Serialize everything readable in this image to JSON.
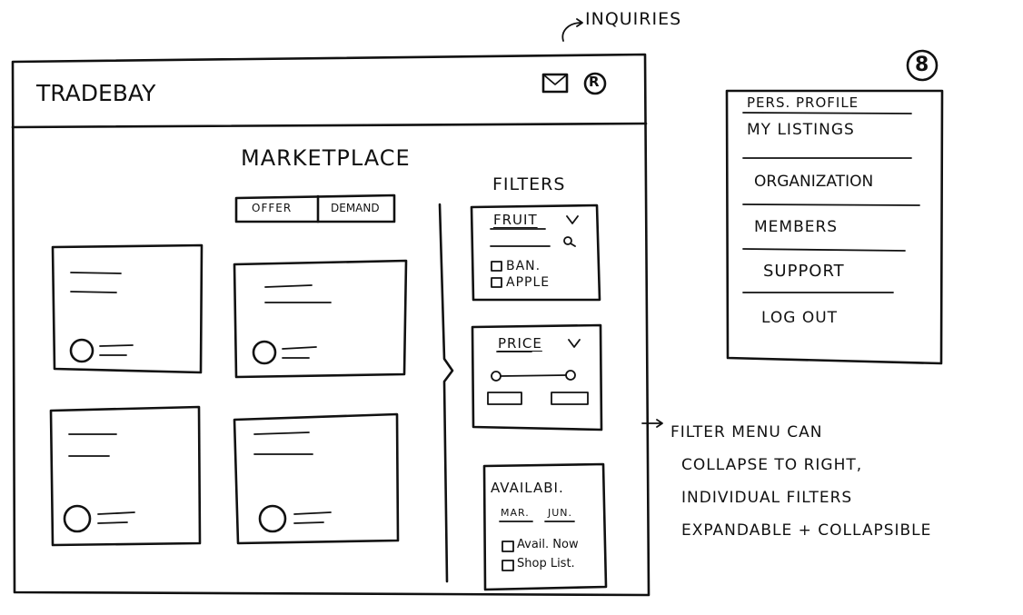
{
  "annotations": {
    "inquiries": "INQUIRIES",
    "filter_note": [
      "FILTER MENU CAN",
      "COLLAPSE TO RIGHT,",
      "INDIVIDUAL FILTERS",
      "EXPANDABLE + COLLAPSIBLE"
    ]
  },
  "header": {
    "logo": "TRADEBAY",
    "mail_icon": "mail-icon",
    "profile_icon": "profile-icon"
  },
  "main": {
    "title": "MARKETPLACE",
    "toggle": {
      "offer": "OFFER",
      "demand": "DEMAND"
    }
  },
  "filters": {
    "title": "FILTERS",
    "fruit": {
      "label": "FRUIT",
      "options": [
        "BAN.",
        "APPLE"
      ]
    },
    "price": {
      "label": "PRICE"
    },
    "availability": {
      "label": "AVAILABI.",
      "range_from": "MAR.",
      "range_to": "JUN.",
      "options": [
        "Avail. Now",
        "Shop List."
      ]
    }
  },
  "profile_menu": {
    "badge": "8",
    "items": [
      "PERS. PROFILE",
      "MY LISTINGS",
      "ORGANIZATION",
      "MEMBERS",
      "SUPPORT",
      "LOG OUT"
    ]
  }
}
